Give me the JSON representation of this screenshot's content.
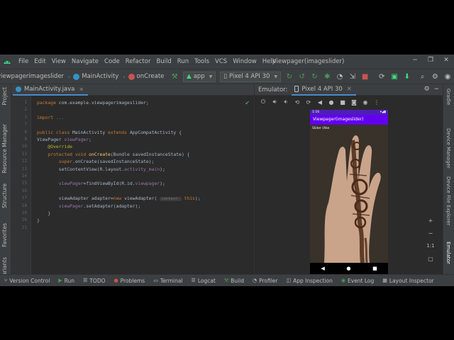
{
  "menu": {
    "items": [
      "File",
      "Edit",
      "View",
      "Navigate",
      "Code",
      "Refactor",
      "Build",
      "Run",
      "Tools",
      "VCS",
      "Window",
      "Help"
    ],
    "window_title": "Viewpager(imageslider)"
  },
  "navbar": {
    "project": "viewpagerimageslider",
    "class": "MainActivity",
    "method": "onCreate",
    "run_config": "app",
    "device": "Pixel 4 API 30"
  },
  "left_strip": [
    "Project",
    "Resource Manager",
    "Structure",
    "Favorites",
    "Variants"
  ],
  "right_strip": [
    "Gradle",
    "Device Manager",
    "Device File Explorer",
    "Emulator"
  ],
  "editor": {
    "tab_label": "MainActivity.java",
    "lines": [
      {
        "n": "1",
        "html": "<span class=\"kw\">package</span> com.example.viewpagerimageslider;"
      },
      {
        "n": "2",
        "html": ""
      },
      {
        "n": "3",
        "html": "<span class=\"kw\">import</span> <span class=\"cmt\">...</span>"
      },
      {
        "n": "7",
        "html": ""
      },
      {
        "n": "8",
        "html": "<span class=\"kw\">public class</span> MainActivity <span class=\"kw\">extends</span> AppCompatActivity {"
      },
      {
        "n": "9",
        "html": "ViewPager <span class=\"fld\">viewPager</span>;"
      },
      {
        "n": "10",
        "html": "    <span class=\"an\">@Override</span>"
      },
      {
        "n": "11",
        "html": "    <span class=\"kw\">protected void</span> <span class=\"fn\">onCreate</span>(Bundle savedInstanceState) {"
      },
      {
        "n": "12",
        "html": "        <span class=\"kw\">super</span>.onCreate(savedInstanceState);"
      },
      {
        "n": "13",
        "html": "        setContentView(R.layout.<span class=\"fld\">activity_main</span>);"
      },
      {
        "n": "14",
        "html": ""
      },
      {
        "n": "15",
        "html": "        <span class=\"fld\">viewPager</span>=findViewById(R.id.<span class=\"fld\">viewpager</span>);"
      },
      {
        "n": "16",
        "html": ""
      },
      {
        "n": "17",
        "html": "        viewAdapter adapter=<span class=\"kw\">new</span> viewAdapter( <span class=\"hint\">context:</span> <span class=\"kw\">this</span>);"
      },
      {
        "n": "18",
        "html": "        <span class=\"fld\">viewPager</span>.setAdapter(adapter);"
      },
      {
        "n": "19",
        "html": "    }"
      },
      {
        "n": "20",
        "html": "}"
      },
      {
        "n": "21",
        "html": ""
      }
    ]
  },
  "emulator": {
    "title": "Emulator:",
    "tab": "Pixel 4 API 30",
    "phone": {
      "time": "1:16",
      "app_title": "Viewpager(imageslider)",
      "slide_label": "Slider (Ake"
    },
    "side_zoom": "1:1"
  },
  "bottom_tools": [
    {
      "icon": "version-control-icon",
      "label": "Version Control"
    },
    {
      "icon": "run-icon",
      "label": "Run"
    },
    {
      "icon": "todo-icon",
      "label": "TODO"
    },
    {
      "icon": "problems-icon",
      "label": "Problems"
    },
    {
      "icon": "terminal-icon",
      "label": "Terminal"
    },
    {
      "icon": "logcat-icon",
      "label": "Logcat"
    },
    {
      "icon": "build-icon",
      "label": "Build"
    },
    {
      "icon": "profiler-icon",
      "label": "Profiler"
    },
    {
      "icon": "app-inspection-icon",
      "label": "App Inspection"
    },
    {
      "icon": "event-log-icon",
      "label": "Event Log"
    },
    {
      "icon": "layout-inspector-icon",
      "label": "Layout Inspector"
    }
  ],
  "colors": {
    "ide_bg": "#2b2b2b",
    "toolbar_bg": "#3c3f41",
    "app_bar": "#6200ee",
    "status_bar": "#4e1fb3",
    "run_green": "#499c54",
    "stop_red": "#c75450"
  }
}
